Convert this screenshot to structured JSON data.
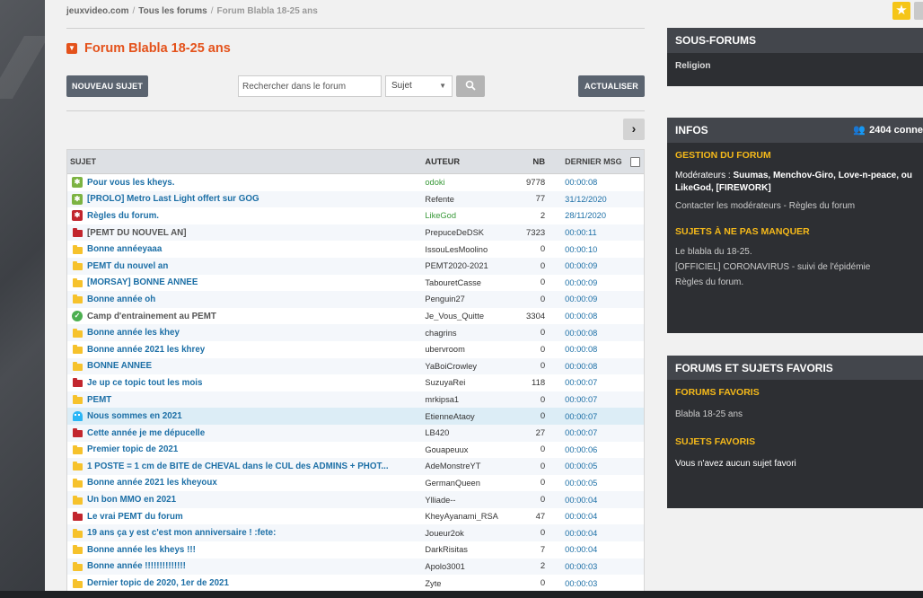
{
  "breadcrumb": [
    "jeuxvideo.com",
    "Tous les forums",
    "Forum Blabla 18-25 ans"
  ],
  "forum_title": "Forum Blabla 18-25 ans",
  "toolbar": {
    "new_topic": "NOUVEAU SUJET",
    "search_placeholder": "Rechercher dans le forum",
    "search_scope": "Sujet",
    "refresh": "ACTUALISER"
  },
  "table": {
    "headers": {
      "subject": "SUJET",
      "author": "AUTEUR",
      "nb": "NB",
      "last": "DERNIER MSG"
    },
    "rows": [
      {
        "icon": "pin-green",
        "subject": "Pour vous les kheys.",
        "author": "odoki",
        "nb": "9778",
        "last": "00:00:08"
      },
      {
        "icon": "pin-green",
        "subject": "[PROLO] Metro Last Light offert sur GOG",
        "author": "Refente",
        "nb": "77",
        "last": "31/12/2020"
      },
      {
        "icon": "pin-red",
        "subject": "Règles du forum.",
        "author": "LikeGod",
        "nb": "2",
        "last": "28/11/2020"
      },
      {
        "icon": "folder-red",
        "subject": "[PEMT DU NOUVEL AN]",
        "author": "PrepuceDeDSK",
        "nb": "7323",
        "last": "00:00:11"
      },
      {
        "icon": "folder-yellow",
        "subject": "Bonne annéeyaaa",
        "author": "IssouLesMoolino",
        "nb": "0",
        "last": "00:00:10"
      },
      {
        "icon": "folder-yellow",
        "subject": "PEMT du nouvel an",
        "author": "PEMT2020-2021",
        "nb": "0",
        "last": "00:00:09"
      },
      {
        "icon": "folder-yellow",
        "subject": "[MORSAY] BONNE ANNEE",
        "author": "TabouretCasse",
        "nb": "0",
        "last": "00:00:09"
      },
      {
        "icon": "folder-yellow",
        "subject": "Bonne année oh",
        "author": "Penguin27",
        "nb": "0",
        "last": "00:00:09"
      },
      {
        "icon": "resolved-check",
        "subject": "Camp d'entrainement au PEMT",
        "author": "Je_Vous_Quitte",
        "nb": "3304",
        "last": "00:00:08"
      },
      {
        "icon": "folder-yellow",
        "subject": "Bonne année les khey",
        "author": "chagrins",
        "nb": "0",
        "last": "00:00:08"
      },
      {
        "icon": "folder-yellow",
        "subject": "Bonne année 2021 les khrey",
        "author": "ubervroom",
        "nb": "0",
        "last": "00:00:08"
      },
      {
        "icon": "folder-yellow",
        "subject": "BONNE ANNEE",
        "author": "YaBoiCrowley",
        "nb": "0",
        "last": "00:00:08"
      },
      {
        "icon": "folder-red",
        "subject": "Je up ce topic tout les mois",
        "author": "SuzuyaRei",
        "nb": "118",
        "last": "00:00:07"
      },
      {
        "icon": "folder-yellow",
        "subject": "PEMT",
        "author": "mrkipsa1",
        "nb": "0",
        "last": "00:00:07"
      },
      {
        "icon": "ghost",
        "subject": "Nous sommes en 2021",
        "author": "EtienneAtaoy",
        "nb": "0",
        "last": "00:00:07"
      },
      {
        "icon": "folder-red",
        "subject": "Cette année je me dépucelle",
        "author": "LB420",
        "nb": "27",
        "last": "00:00:07"
      },
      {
        "icon": "folder-yellow",
        "subject": "Premier topic de 2021",
        "author": "Gouapeuux",
        "nb": "0",
        "last": "00:00:06"
      },
      {
        "icon": "folder-yellow",
        "subject": "1 POSTE = 1 cm de BITE de CHEVAL dans le CUL des ADMINS + PHOT...",
        "author": "AdeMonstreYT",
        "nb": "0",
        "last": "00:00:05"
      },
      {
        "icon": "folder-yellow",
        "subject": "Bonne année 2021 les kheyoux",
        "author": "GermanQueen",
        "nb": "0",
        "last": "00:00:05"
      },
      {
        "icon": "folder-yellow",
        "subject": "Un bon MMO en 2021",
        "author": "Ylliade--",
        "nb": "0",
        "last": "00:00:04"
      },
      {
        "icon": "folder-red",
        "subject": "Le vrai PEMT du forum",
        "author": "KheyAyanami_RSA",
        "nb": "47",
        "last": "00:00:04"
      },
      {
        "icon": "folder-yellow",
        "subject": "19 ans ça y est c'est mon anniversaire ! :fete:",
        "author": "Joueur2ok",
        "nb": "0",
        "last": "00:00:04"
      },
      {
        "icon": "folder-yellow",
        "subject": "Bonne année les kheys !!!",
        "author": "DarkRisitas",
        "nb": "7",
        "last": "00:00:04"
      },
      {
        "icon": "folder-yellow",
        "subject": "Bonne année !!!!!!!!!!!!!!",
        "author": "Apolo3001",
        "nb": "2",
        "last": "00:00:03"
      },
      {
        "icon": "folder-yellow",
        "subject": "Dernier topic de 2020, 1er de 2021",
        "author": "Zyte",
        "nb": "0",
        "last": "00:00:03"
      }
    ]
  },
  "sous_forums": {
    "title": "SOUS-FORUMS",
    "items": [
      "Religion"
    ]
  },
  "infos": {
    "title": "INFOS",
    "online": "2404 conne",
    "gestion_title": "GESTION DU FORUM",
    "moderators_label": "Modérateurs : ",
    "moderators": "Suumas, Menchov-Giro, Love-n-peace, ou LikeGod, [FIREWORK]",
    "contact": "Contacter les modérateurs - Règles du forum",
    "must_see_title": "SUJETS À NE PAS MANQUER",
    "must_see": [
      "Le blabla du 18-25.",
      "[OFFICIEL] CORONAVIRUS - suivi de l'épidémie",
      "Règles du forum."
    ]
  },
  "favs": {
    "title": "FORUMS ET SUJETS FAVORIS",
    "forums_title": "FORUMS FAVORIS",
    "forums": [
      "Blabla 18-25 ans"
    ],
    "topics_title": "SUJETS FAVORIS",
    "topics_empty": "Vous n'avez aucun sujet favori"
  },
  "colors": {
    "accent": "#e4521b",
    "link": "#1c6fa6",
    "panel_gold": "#f5b91a"
  }
}
